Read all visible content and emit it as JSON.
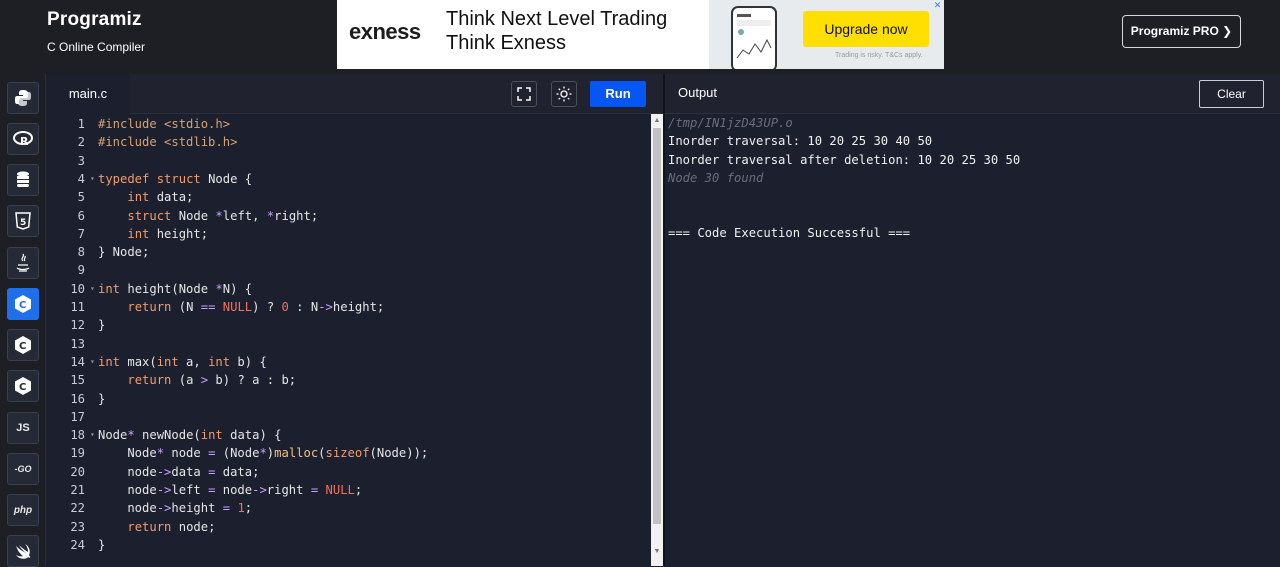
{
  "header": {
    "logo_text": "Programiz",
    "subtitle": "C Online Compiler",
    "pro_button": "Programiz PRO ❯"
  },
  "ad": {
    "brand": "exness",
    "line1": "Think Next Level Trading",
    "line2": "Think Exness",
    "cta": "Upgrade now",
    "risk": "Trading is risky. T&Cs apply.",
    "close": "✕"
  },
  "sidebar": {
    "items": [
      {
        "icon": "python-icon",
        "label": "Py",
        "active": false
      },
      {
        "icon": "r-icon",
        "label": "R",
        "active": false
      },
      {
        "icon": "sql-icon",
        "label": "≡",
        "active": false
      },
      {
        "icon": "html5-icon",
        "label": "5",
        "active": false
      },
      {
        "icon": "java-icon",
        "label": "♨",
        "active": false
      },
      {
        "icon": "c-icon",
        "label": "C",
        "active": true
      },
      {
        "icon": "cpp-icon",
        "label": "C",
        "active": false
      },
      {
        "icon": "csharp-icon",
        "label": "C",
        "active": false
      },
      {
        "icon": "js-icon",
        "label": "JS",
        "active": false
      },
      {
        "icon": "go-icon",
        "label": "-GO",
        "active": false
      },
      {
        "icon": "php-icon",
        "label": "php",
        "active": false
      },
      {
        "icon": "swift-icon",
        "label": "✈",
        "active": false
      }
    ]
  },
  "editor": {
    "tab": "main.c",
    "run_label": "Run",
    "lines": [
      {
        "n": "1",
        "fold": false,
        "html": "<span class='pp'>#include &lt;stdio.h&gt;</span>"
      },
      {
        "n": "2",
        "fold": false,
        "html": "<span class='pp'>#include &lt;stdlib.h&gt;</span>"
      },
      {
        "n": "3",
        "fold": false,
        "html": ""
      },
      {
        "n": "4",
        "fold": true,
        "html": "<span class='kw'>typedef</span> <span class='kw'>struct</span> Node {"
      },
      {
        "n": "5",
        "fold": false,
        "html": "    <span class='kw'>int</span> data;"
      },
      {
        "n": "6",
        "fold": false,
        "html": "    <span class='kw'>struct</span> Node <span class='op'>*</span>left, <span class='op'>*</span>right;"
      },
      {
        "n": "7",
        "fold": false,
        "html": "    <span class='kw'>int</span> height;"
      },
      {
        "n": "8",
        "fold": false,
        "html": "} Node;"
      },
      {
        "n": "9",
        "fold": false,
        "html": ""
      },
      {
        "n": "10",
        "fold": true,
        "html": "<span class='kw'>int</span> height(Node <span class='op'>*</span>N) {"
      },
      {
        "n": "11",
        "fold": false,
        "html": "    <span class='kw'>return</span> (N <span class='op'>==</span> <span class='num'>NULL</span>) ? <span class='num'>0</span> : N<span class='op'>-&gt;</span>height;"
      },
      {
        "n": "12",
        "fold": false,
        "html": "}"
      },
      {
        "n": "13",
        "fold": false,
        "html": ""
      },
      {
        "n": "14",
        "fold": true,
        "html": "<span class='kw'>int</span> max(<span class='kw'>int</span> a, <span class='kw'>int</span> b) {"
      },
      {
        "n": "15",
        "fold": false,
        "html": "    <span class='kw'>return</span> (a <span class='op'>&gt;</span> b) ? a : b;"
      },
      {
        "n": "16",
        "fold": false,
        "html": "}"
      },
      {
        "n": "17",
        "fold": false,
        "html": ""
      },
      {
        "n": "18",
        "fold": true,
        "html": "Node<span class='op'>*</span> newNode(<span class='kw'>int</span> data) {"
      },
      {
        "n": "19",
        "fold": false,
        "html": "    Node<span class='op'>*</span> node <span class='op'>=</span> (Node<span class='op'>*</span>)<span class='typ'>malloc</span>(<span class='kw'>sizeof</span>(Node));"
      },
      {
        "n": "20",
        "fold": false,
        "html": "    node<span class='op'>-&gt;</span>data <span class='op'>=</span> data;"
      },
      {
        "n": "21",
        "fold": false,
        "html": "    node<span class='op'>-&gt;</span>left <span class='op'>=</span> node<span class='op'>-&gt;</span>right <span class='op'>=</span> <span class='num'>NULL</span>;"
      },
      {
        "n": "22",
        "fold": false,
        "html": "    node<span class='op'>-&gt;</span>height <span class='op'>=</span> <span class='num'>1</span>;"
      },
      {
        "n": "23",
        "fold": false,
        "html": "    <span class='kw'>return</span> node;"
      },
      {
        "n": "24",
        "fold": false,
        "html": "}"
      }
    ]
  },
  "output": {
    "title": "Output",
    "clear_label": "Clear",
    "lines": [
      {
        "text": "/tmp/IN1jzD43UP.o",
        "dim": true
      },
      {
        "text": "Inorder traversal: 10 20 25 30 40 50",
        "dim": false
      },
      {
        "text": "Inorder traversal after deletion: 10 20 25 30 50",
        "dim": false
      },
      {
        "text": "Node 30 found",
        "dim": true
      },
      {
        "text": "",
        "dim": false
      },
      {
        "text": "",
        "dim": false
      },
      {
        "text": "=== Code Execution Successful ===",
        "dim": false
      }
    ]
  }
}
